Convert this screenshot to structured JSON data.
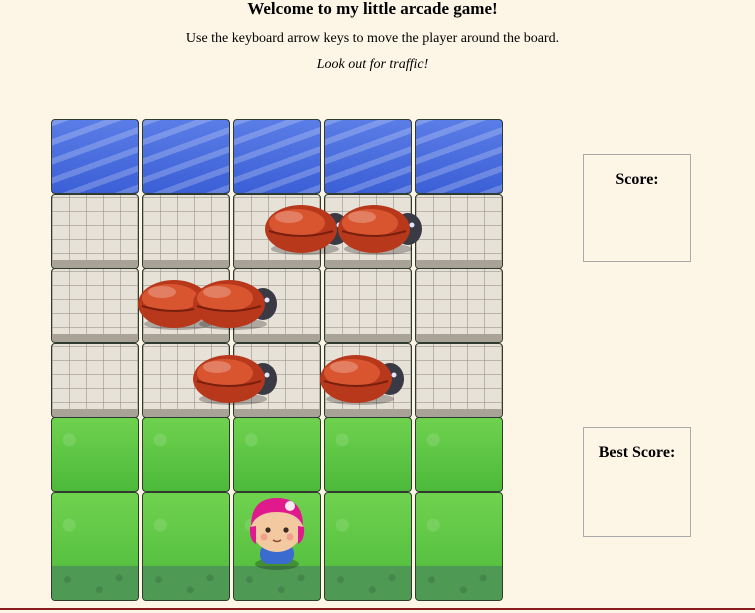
{
  "header": {
    "title": "Welcome to my little arcade game!",
    "instructions": "Use the keyboard arrow keys to move the player around the board.",
    "warning": "Look out for traffic!"
  },
  "board": {
    "columns": 5,
    "rows": 6,
    "row_types": [
      "water",
      "stone",
      "stone",
      "stone",
      "grass",
      "grass"
    ],
    "enemies": [
      {
        "row": 1,
        "col": 2.4
      },
      {
        "row": 1,
        "col": 3.2
      },
      {
        "row": 2,
        "col": 1.0
      },
      {
        "row": 2,
        "col": 1.6
      },
      {
        "row": 3,
        "col": 1.6
      },
      {
        "row": 3,
        "col": 3.0
      }
    ],
    "player": {
      "row": 5,
      "col": 2
    }
  },
  "score_panel": {
    "label": "Score:",
    "value": ""
  },
  "best_score_panel": {
    "label": "Best Score:",
    "value": ""
  },
  "colors": {
    "background": "#fdf5e6",
    "water": "#4a6fe0",
    "stone": "#e7e2d8",
    "grass": "#5cc443",
    "enemy_shell": "#b8381c",
    "bottom_rule": "#8b1a1a"
  }
}
